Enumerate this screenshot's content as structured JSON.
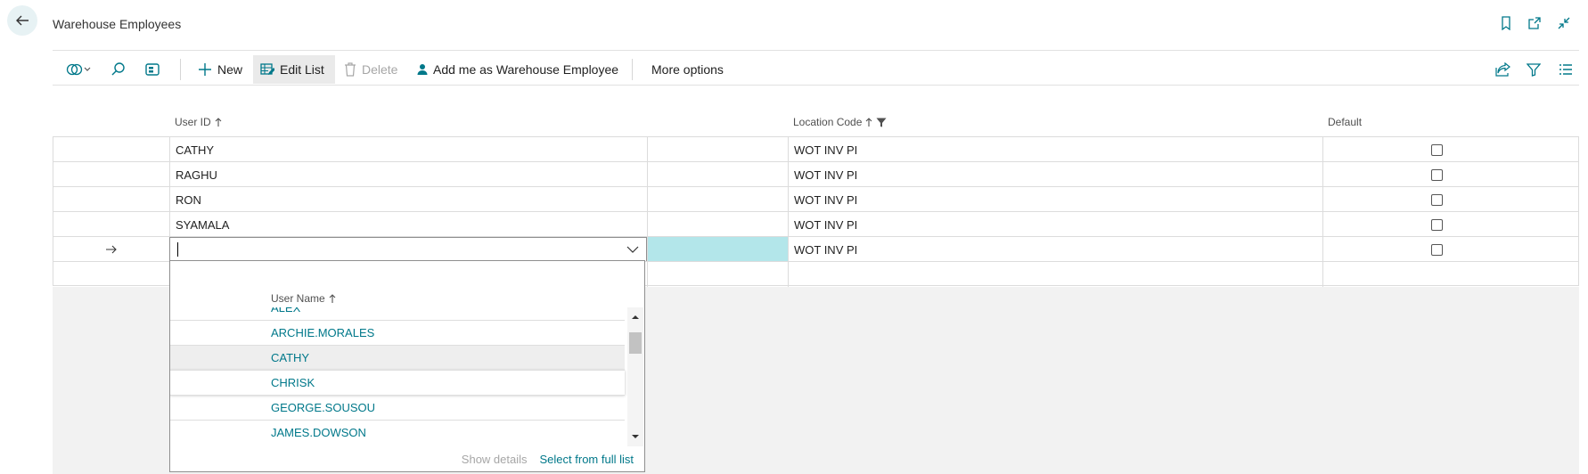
{
  "header": {
    "title": "Warehouse Employees",
    "icons": [
      "back-arrow-icon",
      "bookmark-icon",
      "open-new-window-icon",
      "collapse-icon"
    ]
  },
  "actions": {
    "new": "New",
    "edit_list": "Edit List",
    "delete": "Delete",
    "add_me": "Add me as Warehouse Employee",
    "more": "More options"
  },
  "columns": {
    "user_id": "User ID",
    "location_code": "Location Code",
    "default": "Default"
  },
  "rows": [
    {
      "user_id": "CATHY",
      "location": "WOT INV PI",
      "default": false
    },
    {
      "user_id": "RAGHU",
      "location": "WOT INV PI",
      "default": false
    },
    {
      "user_id": "RON",
      "location": "WOT INV PI",
      "default": false
    },
    {
      "user_id": "SYAMALA",
      "location": "WOT INV PI",
      "default": false
    },
    {
      "user_id": "",
      "location": "WOT INV PI",
      "default": false
    }
  ],
  "lookup": {
    "column_header": "User Name",
    "items": [
      "ALEX",
      "ARCHIE.MORALES",
      "CATHY",
      "CHRISK",
      "GEORGE.SOUSOU",
      "JAMES.DOWSON"
    ],
    "show_details": "Show details",
    "select_full": "Select from full list"
  },
  "colors": {
    "accent": "#00788a",
    "edit_highlight": "#b3e6ea",
    "back_button_bg": "#e7f2f4"
  }
}
